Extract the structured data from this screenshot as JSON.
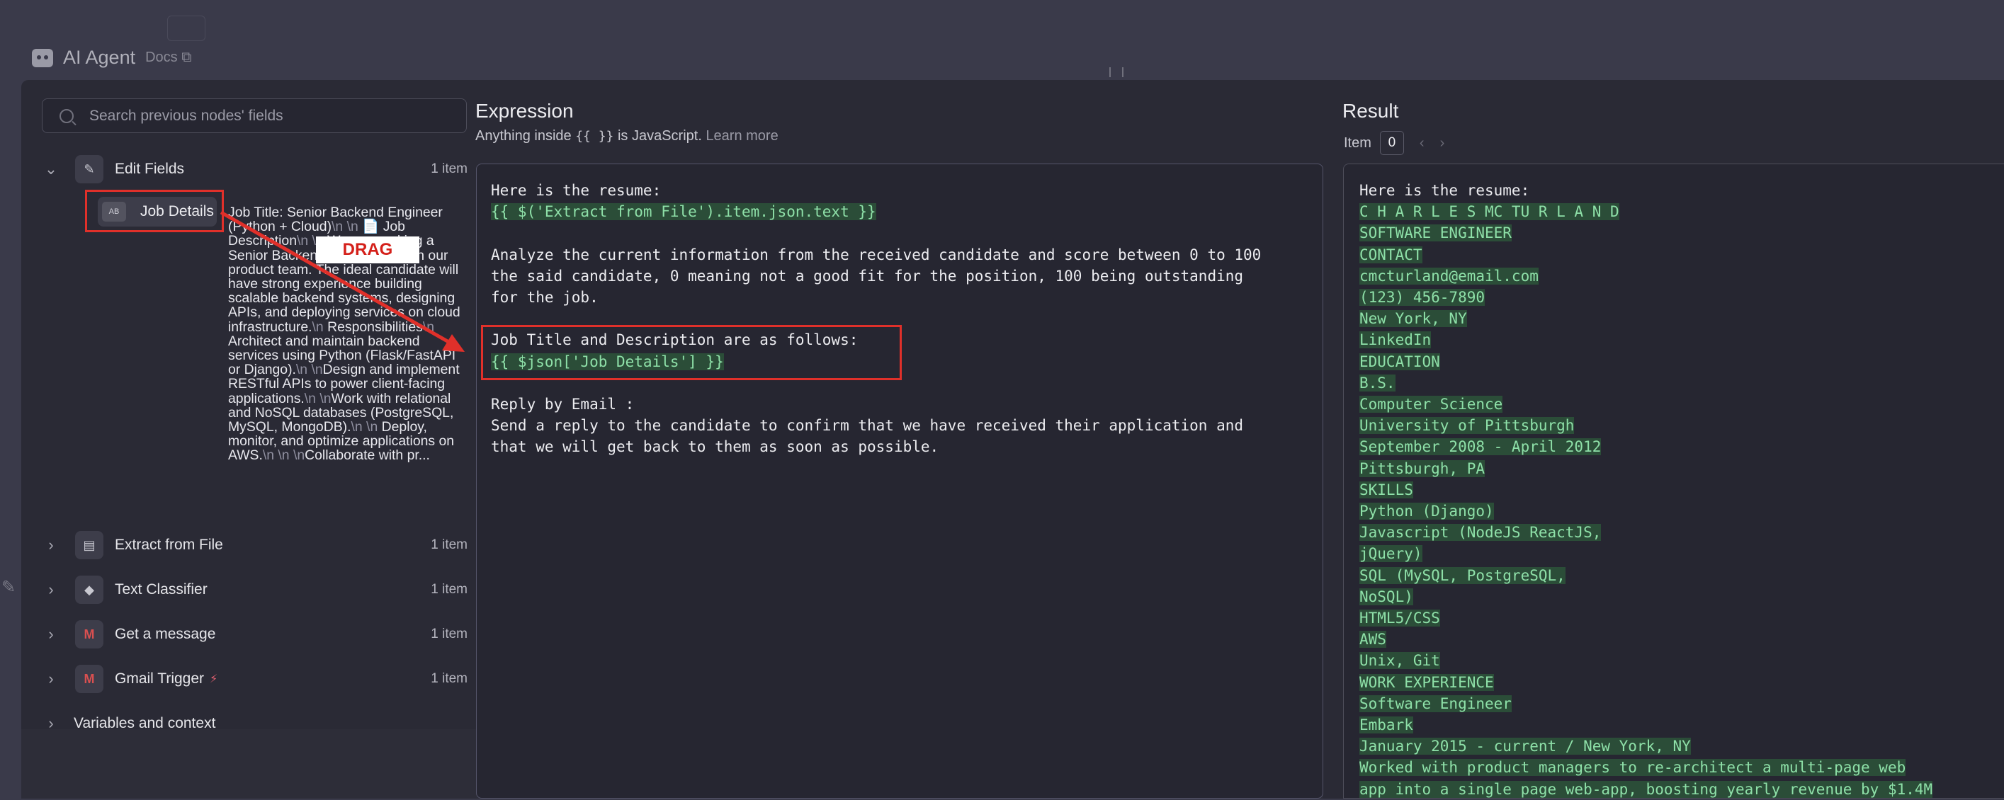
{
  "header": {
    "title": "AI Agent",
    "docs_label": "Docs"
  },
  "left_panel": {
    "search_placeholder": "Search previous nodes' fields",
    "nodes": [
      {
        "name": "Edit Fields",
        "count": "1 item",
        "expanded": true,
        "icon": "pencil-icon"
      },
      {
        "name": "Extract from File",
        "count": "1 item",
        "icon": "file-icon"
      },
      {
        "name": "Text Classifier",
        "count": "1 item",
        "icon": "tag-icon"
      },
      {
        "name": "Get a message",
        "count": "1 item",
        "icon": "gmail-icon"
      },
      {
        "name": "Gmail Trigger",
        "count": "1 item",
        "icon": "gmail-icon",
        "trigger_icon": "bolt-icon"
      }
    ],
    "field": {
      "type_badge": "AB",
      "name": "Job Details",
      "preview": [
        {
          "t": "Job Title: Senior Backend Engineer (Python + Cloud)"
        },
        {
          "t": "\\n \\n",
          "nl": true
        },
        {
          "t": " 📄 Job Description"
        },
        {
          "t": "\\n \\n",
          "nl": true
        },
        {
          "t": " We are seeking a Senior Backend Engineer to join our product team. The ideal candidate will have strong experience building scalable backend systems, designing APIs, and deploying services on cloud infrastructure."
        },
        {
          "t": "\\n",
          "nl": true
        },
        {
          "t": " Responsibilities"
        },
        {
          "t": "\\n",
          "nl": true
        },
        {
          "t": " Architect and maintain backend services using Python (Flask/FastAPI or Django)."
        },
        {
          "t": "\\n \\n",
          "nl": true
        },
        {
          "t": "Design and implement RESTful APIs to power client-facing applications."
        },
        {
          "t": "\\n \\n",
          "nl": true
        },
        {
          "t": "Work with relational and NoSQL databases (PostgreSQL, MySQL, MongoDB)."
        },
        {
          "t": "\\n \\n",
          "nl": true
        },
        {
          "t": " Deploy, monitor, and optimize applications on AWS."
        },
        {
          "t": "\\n \\n \\n",
          "nl": true
        },
        {
          "t": "Collaborate with pr..."
        }
      ]
    },
    "variables_label": "Variables and context"
  },
  "annotation": {
    "drag_label": "DRAG"
  },
  "expression": {
    "title": "Expression",
    "subtitle_prefix": "Anything inside ",
    "subtitle_braces": "{{ }}",
    "subtitle_suffix": " is JavaScript.",
    "learn_more": "Learn more",
    "lines": [
      {
        "text": "Here is the resume:"
      },
      {
        "text": "{{ $('Extract from File').item.json.text }}",
        "hl": true
      },
      {
        "text": ""
      },
      {
        "text": "Analyze the current information from the received candidate and score between 0 to 100"
      },
      {
        "text": "the said candidate, 0 meaning not a good fit for the position, 100 being outstanding"
      },
      {
        "text": "for the job."
      },
      {
        "text": ""
      },
      {
        "text": "Job Title and Description are as follows:"
      },
      {
        "text": "{{ $json['Job Details'] }}",
        "hl": true
      },
      {
        "text": ""
      },
      {
        "text": "Reply by Email :"
      },
      {
        "text": "Send a reply to the candidate to confirm that we have received their application and"
      },
      {
        "text": "that we will get back to them as soon as possible."
      }
    ]
  },
  "result": {
    "title": "Result",
    "item_label": "Item",
    "item_index": "0",
    "prev_icon": "chevron-left-icon",
    "next_icon": "chevron-right-icon",
    "lines": [
      {
        "text": "Here is the resume:"
      },
      {
        "text": "C H A R L E S MC TU R L A N D",
        "hl": true
      },
      {
        "text": "SOFTWARE ENGINEER",
        "hl": true
      },
      {
        "text": "CONTACT",
        "hl": true
      },
      {
        "text": "cmcturland@email.com",
        "hl": true
      },
      {
        "text": "(123) 456-7890",
        "hl": true
      },
      {
        "text": "New York, NY",
        "hl": true
      },
      {
        "text": "LinkedIn",
        "hl": true
      },
      {
        "text": "EDUCATION",
        "hl": true
      },
      {
        "text": "B.S.",
        "hl": true
      },
      {
        "text": "Computer Science",
        "hl": true
      },
      {
        "text": "University of Pittsburgh",
        "hl": true
      },
      {
        "text": "September 2008 - April 2012",
        "hl": true
      },
      {
        "text": "Pittsburgh, PA",
        "hl": true
      },
      {
        "text": "SKILLS",
        "hl": true
      },
      {
        "text": "Python (Django)",
        "hl": true
      },
      {
        "text": "Javascript (NodeJS ReactJS,",
        "hl": true
      },
      {
        "text": "jQuery)",
        "hl": true
      },
      {
        "text": "SQL (MySQL, PostgreSQL,",
        "hl": true
      },
      {
        "text": "NoSQL)",
        "hl": true
      },
      {
        "text": "HTML5/CSS",
        "hl": true
      },
      {
        "text": "AWS",
        "hl": true
      },
      {
        "text": "Unix, Git",
        "hl": true
      },
      {
        "text": "WORK EXPERIENCE",
        "hl": true
      },
      {
        "text": "Software Engineer",
        "hl": true
      },
      {
        "text": "Embark",
        "hl": true
      },
      {
        "text": "January 2015 - current / New York, NY",
        "hl": true
      },
      {
        "text": "Worked with product managers to re-architect a multi-page web",
        "hl": true
      },
      {
        "text": "app into a single page web-app, boosting yearly revenue by $1.4M",
        "hl": true
      }
    ]
  },
  "colors": {
    "annotation_red": "#e0302a",
    "expression_highlight": "#8ee0a8",
    "background": "#2a2a35"
  }
}
